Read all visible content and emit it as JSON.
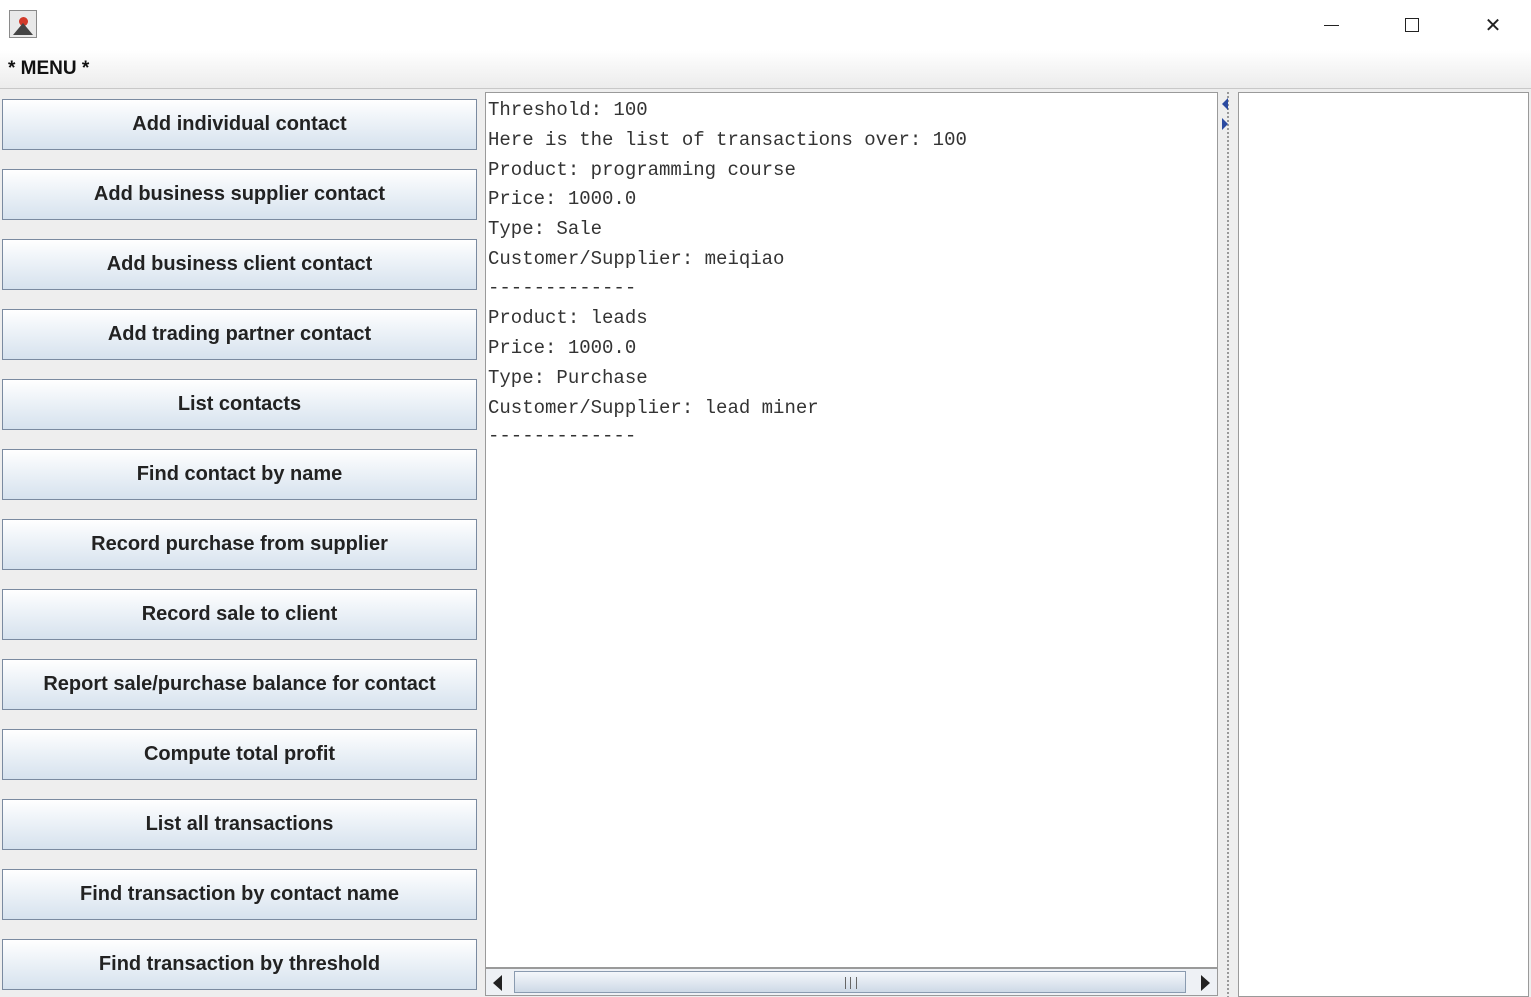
{
  "window": {
    "icon": "java-duke-icon",
    "controls": {
      "minimize": "minimize-icon",
      "maximize": "maximize-icon",
      "close": "close-icon",
      "close_glyph": "✕"
    }
  },
  "menu": {
    "label": "* MENU *"
  },
  "buttons": [
    "Add individual contact",
    "Add business supplier contact",
    "Add business client contact",
    "Add trading partner contact",
    "List contacts",
    "Find contact by name",
    "Record purchase from supplier",
    "Record sale to client",
    "Report sale/purchase balance for contact",
    "Compute total profit",
    "List all transactions",
    "Find transaction by contact name",
    "Find transaction by threshold"
  ],
  "output": {
    "lines": [
      "Threshold: 100",
      "Here is the list of transactions over: 100",
      "Product: programming course",
      "Price: 1000.0",
      "Type: Sale",
      "Customer/Supplier: meiqiao",
      "-------------",
      "Product: leads",
      "Price: 1000.0",
      "Type: Purchase",
      "Customer/Supplier: lead miner",
      "-------------"
    ]
  },
  "scrollbar": {
    "left_icon": "arrow-left-icon",
    "right_icon": "arrow-right-icon"
  },
  "divider": {
    "left_icon": "collapse-left-icon",
    "right_icon": "expand-right-icon"
  }
}
